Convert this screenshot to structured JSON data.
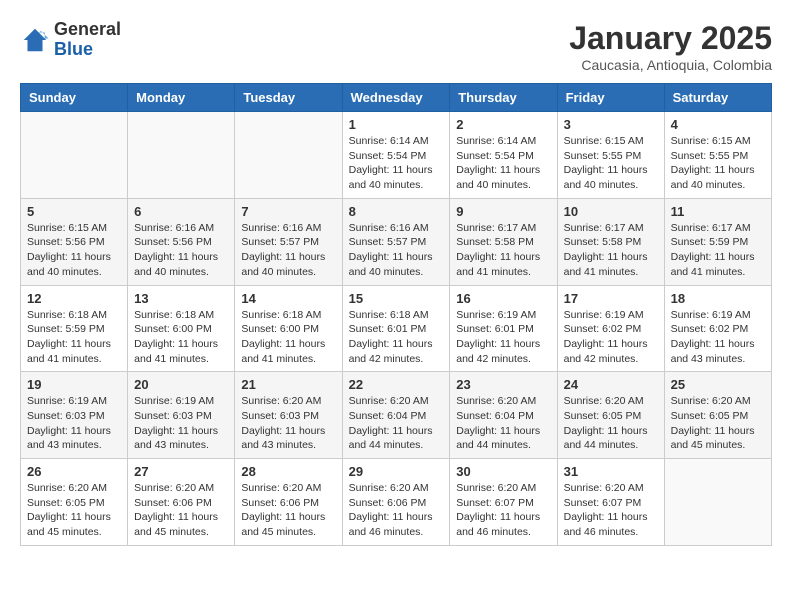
{
  "header": {
    "logo_general": "General",
    "logo_blue": "Blue",
    "title": "January 2025",
    "subtitle": "Caucasia, Antioquia, Colombia"
  },
  "weekdays": [
    "Sunday",
    "Monday",
    "Tuesday",
    "Wednesday",
    "Thursday",
    "Friday",
    "Saturday"
  ],
  "weeks": [
    [
      {
        "day": "",
        "info": ""
      },
      {
        "day": "",
        "info": ""
      },
      {
        "day": "",
        "info": ""
      },
      {
        "day": "1",
        "info": "Sunrise: 6:14 AM\nSunset: 5:54 PM\nDaylight: 11 hours and 40 minutes."
      },
      {
        "day": "2",
        "info": "Sunrise: 6:14 AM\nSunset: 5:54 PM\nDaylight: 11 hours and 40 minutes."
      },
      {
        "day": "3",
        "info": "Sunrise: 6:15 AM\nSunset: 5:55 PM\nDaylight: 11 hours and 40 minutes."
      },
      {
        "day": "4",
        "info": "Sunrise: 6:15 AM\nSunset: 5:55 PM\nDaylight: 11 hours and 40 minutes."
      }
    ],
    [
      {
        "day": "5",
        "info": "Sunrise: 6:15 AM\nSunset: 5:56 PM\nDaylight: 11 hours and 40 minutes."
      },
      {
        "day": "6",
        "info": "Sunrise: 6:16 AM\nSunset: 5:56 PM\nDaylight: 11 hours and 40 minutes."
      },
      {
        "day": "7",
        "info": "Sunrise: 6:16 AM\nSunset: 5:57 PM\nDaylight: 11 hours and 40 minutes."
      },
      {
        "day": "8",
        "info": "Sunrise: 6:16 AM\nSunset: 5:57 PM\nDaylight: 11 hours and 40 minutes."
      },
      {
        "day": "9",
        "info": "Sunrise: 6:17 AM\nSunset: 5:58 PM\nDaylight: 11 hours and 41 minutes."
      },
      {
        "day": "10",
        "info": "Sunrise: 6:17 AM\nSunset: 5:58 PM\nDaylight: 11 hours and 41 minutes."
      },
      {
        "day": "11",
        "info": "Sunrise: 6:17 AM\nSunset: 5:59 PM\nDaylight: 11 hours and 41 minutes."
      }
    ],
    [
      {
        "day": "12",
        "info": "Sunrise: 6:18 AM\nSunset: 5:59 PM\nDaylight: 11 hours and 41 minutes."
      },
      {
        "day": "13",
        "info": "Sunrise: 6:18 AM\nSunset: 6:00 PM\nDaylight: 11 hours and 41 minutes."
      },
      {
        "day": "14",
        "info": "Sunrise: 6:18 AM\nSunset: 6:00 PM\nDaylight: 11 hours and 41 minutes."
      },
      {
        "day": "15",
        "info": "Sunrise: 6:18 AM\nSunset: 6:01 PM\nDaylight: 11 hours and 42 minutes."
      },
      {
        "day": "16",
        "info": "Sunrise: 6:19 AM\nSunset: 6:01 PM\nDaylight: 11 hours and 42 minutes."
      },
      {
        "day": "17",
        "info": "Sunrise: 6:19 AM\nSunset: 6:02 PM\nDaylight: 11 hours and 42 minutes."
      },
      {
        "day": "18",
        "info": "Sunrise: 6:19 AM\nSunset: 6:02 PM\nDaylight: 11 hours and 43 minutes."
      }
    ],
    [
      {
        "day": "19",
        "info": "Sunrise: 6:19 AM\nSunset: 6:03 PM\nDaylight: 11 hours and 43 minutes."
      },
      {
        "day": "20",
        "info": "Sunrise: 6:19 AM\nSunset: 6:03 PM\nDaylight: 11 hours and 43 minutes."
      },
      {
        "day": "21",
        "info": "Sunrise: 6:20 AM\nSunset: 6:03 PM\nDaylight: 11 hours and 43 minutes."
      },
      {
        "day": "22",
        "info": "Sunrise: 6:20 AM\nSunset: 6:04 PM\nDaylight: 11 hours and 44 minutes."
      },
      {
        "day": "23",
        "info": "Sunrise: 6:20 AM\nSunset: 6:04 PM\nDaylight: 11 hours and 44 minutes."
      },
      {
        "day": "24",
        "info": "Sunrise: 6:20 AM\nSunset: 6:05 PM\nDaylight: 11 hours and 44 minutes."
      },
      {
        "day": "25",
        "info": "Sunrise: 6:20 AM\nSunset: 6:05 PM\nDaylight: 11 hours and 45 minutes."
      }
    ],
    [
      {
        "day": "26",
        "info": "Sunrise: 6:20 AM\nSunset: 6:05 PM\nDaylight: 11 hours and 45 minutes."
      },
      {
        "day": "27",
        "info": "Sunrise: 6:20 AM\nSunset: 6:06 PM\nDaylight: 11 hours and 45 minutes."
      },
      {
        "day": "28",
        "info": "Sunrise: 6:20 AM\nSunset: 6:06 PM\nDaylight: 11 hours and 45 minutes."
      },
      {
        "day": "29",
        "info": "Sunrise: 6:20 AM\nSunset: 6:06 PM\nDaylight: 11 hours and 46 minutes."
      },
      {
        "day": "30",
        "info": "Sunrise: 6:20 AM\nSunset: 6:07 PM\nDaylight: 11 hours and 46 minutes."
      },
      {
        "day": "31",
        "info": "Sunrise: 6:20 AM\nSunset: 6:07 PM\nDaylight: 11 hours and 46 minutes."
      },
      {
        "day": "",
        "info": ""
      }
    ]
  ]
}
